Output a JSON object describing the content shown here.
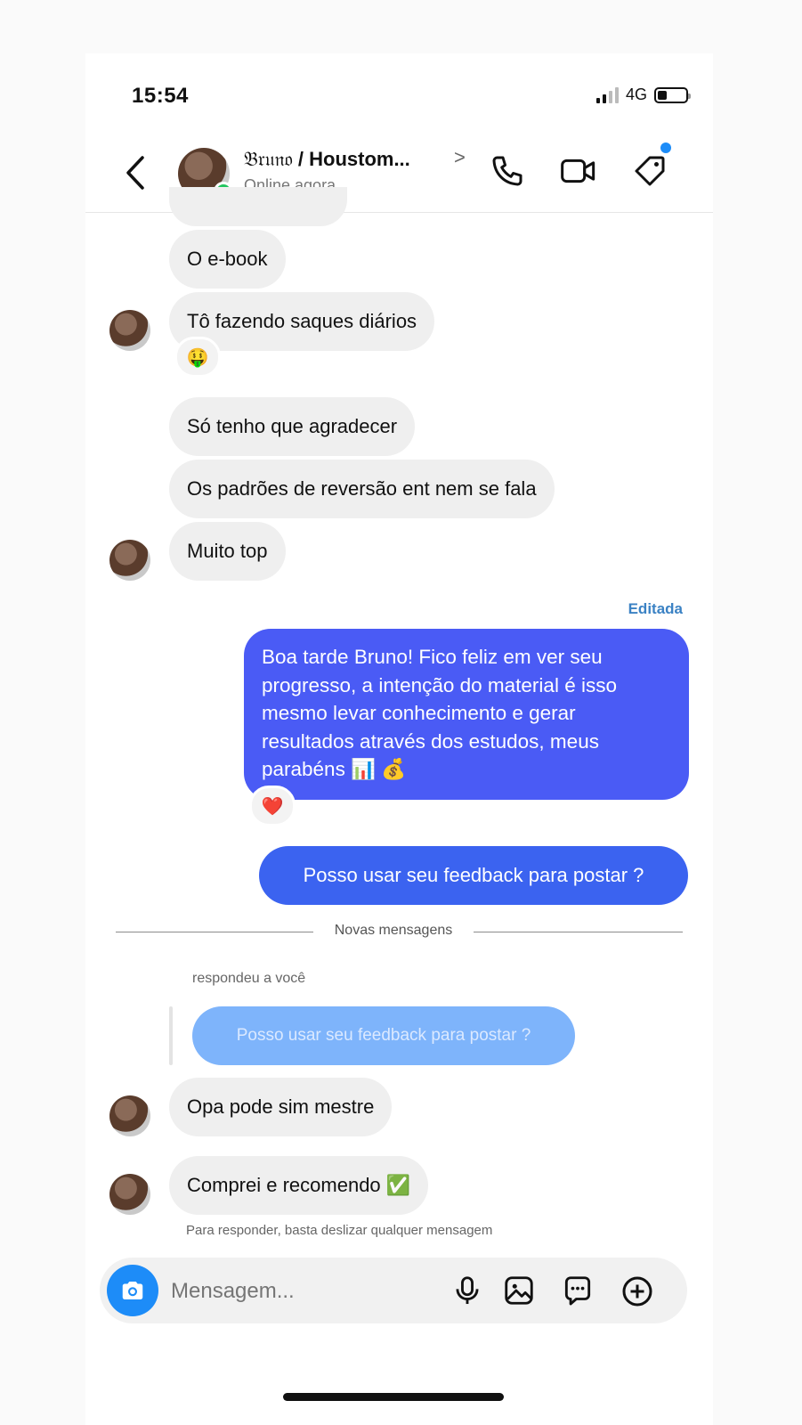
{
  "status_bar": {
    "time": "15:54",
    "network": "4G",
    "battery_level": 0.3
  },
  "header": {
    "contact_name_styled": "𝔅𝔯𝔲𝔫𝔬",
    "contact_name_rest": " / Houstom...",
    "status": "Online agora",
    "icons": [
      "back-chevron-icon",
      "phone-icon",
      "video-icon",
      "tag-icon"
    ]
  },
  "messages": [
    {
      "text": "O e-book",
      "side": "in"
    },
    {
      "text": "Tô fazendo saques diários",
      "side": "in",
      "reaction": "🤑"
    },
    {
      "text": "Só tenho que agradecer",
      "side": "in"
    },
    {
      "text": "Os padrões de reversão ent nem se fala",
      "side": "in"
    },
    {
      "text": "Muito top",
      "side": "in"
    }
  ],
  "outgoing": {
    "edited_label": "Editada",
    "long_text": "Boa tarde Bruno! Fico feliz em ver seu\nprogresso, a intenção do material é isso\nmesmo levar conhecimento e gerar\nresultados através dos estudos, meus\nparabéns 📊 💰",
    "long_reaction": "❤️",
    "short_text": "Posso usar seu feedback para postar ?"
  },
  "new_messages_label": "Novas mensagens",
  "reply": {
    "label": "respondeu a você",
    "quoted_text": "Posso usar seu feedback para postar ?"
  },
  "new_messages": [
    {
      "text": "Opa pode sim mestre"
    },
    {
      "text": "Comprei e recomendo ✅"
    }
  ],
  "hint": "Para responder, basta deslizar qualquer mensagem",
  "composer": {
    "placeholder": "Mensagem...",
    "icons": [
      "camera-icon",
      "microphone-icon",
      "gallery-icon",
      "sticker-icon",
      "plus-icon"
    ]
  },
  "colors": {
    "outgoing": "#4a5bf5",
    "accent": "#1d8cf8",
    "incoming": "#efefef"
  }
}
